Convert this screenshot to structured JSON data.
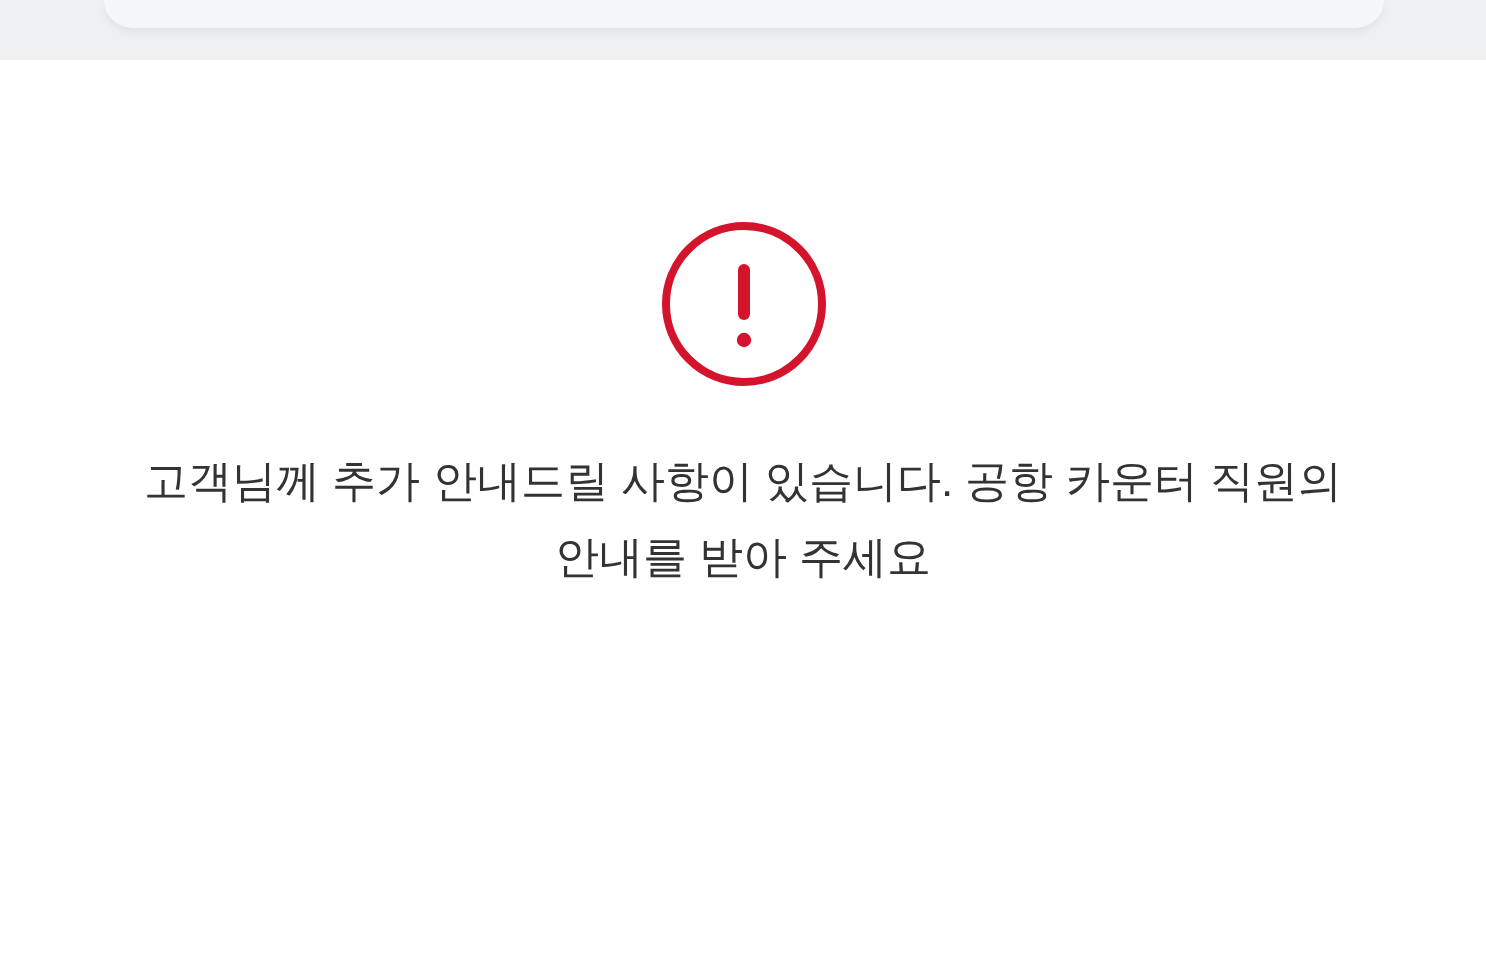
{
  "notice": {
    "kind": "warning",
    "message": "고객님께 추가 안내드릴 사항이 있습니다. 공항 카운터 직원의 안내를 받아 주세요"
  }
}
